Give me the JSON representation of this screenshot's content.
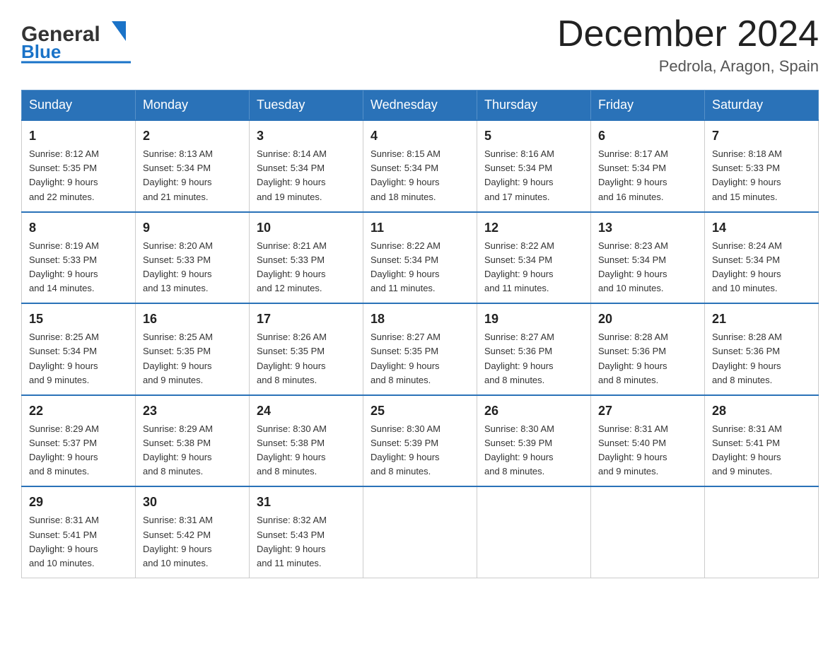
{
  "header": {
    "logo_general": "General",
    "logo_blue": "Blue",
    "month_title": "December 2024",
    "location": "Pedrola, Aragon, Spain"
  },
  "days_of_week": [
    "Sunday",
    "Monday",
    "Tuesday",
    "Wednesday",
    "Thursday",
    "Friday",
    "Saturday"
  ],
  "weeks": [
    [
      {
        "day": "1",
        "sunrise": "8:12 AM",
        "sunset": "5:35 PM",
        "daylight": "9 hours and 22 minutes."
      },
      {
        "day": "2",
        "sunrise": "8:13 AM",
        "sunset": "5:34 PM",
        "daylight": "9 hours and 21 minutes."
      },
      {
        "day": "3",
        "sunrise": "8:14 AM",
        "sunset": "5:34 PM",
        "daylight": "9 hours and 19 minutes."
      },
      {
        "day": "4",
        "sunrise": "8:15 AM",
        "sunset": "5:34 PM",
        "daylight": "9 hours and 18 minutes."
      },
      {
        "day": "5",
        "sunrise": "8:16 AM",
        "sunset": "5:34 PM",
        "daylight": "9 hours and 17 minutes."
      },
      {
        "day": "6",
        "sunrise": "8:17 AM",
        "sunset": "5:34 PM",
        "daylight": "9 hours and 16 minutes."
      },
      {
        "day": "7",
        "sunrise": "8:18 AM",
        "sunset": "5:33 PM",
        "daylight": "9 hours and 15 minutes."
      }
    ],
    [
      {
        "day": "8",
        "sunrise": "8:19 AM",
        "sunset": "5:33 PM",
        "daylight": "9 hours and 14 minutes."
      },
      {
        "day": "9",
        "sunrise": "8:20 AM",
        "sunset": "5:33 PM",
        "daylight": "9 hours and 13 minutes."
      },
      {
        "day": "10",
        "sunrise": "8:21 AM",
        "sunset": "5:33 PM",
        "daylight": "9 hours and 12 minutes."
      },
      {
        "day": "11",
        "sunrise": "8:22 AM",
        "sunset": "5:34 PM",
        "daylight": "9 hours and 11 minutes."
      },
      {
        "day": "12",
        "sunrise": "8:22 AM",
        "sunset": "5:34 PM",
        "daylight": "9 hours and 11 minutes."
      },
      {
        "day": "13",
        "sunrise": "8:23 AM",
        "sunset": "5:34 PM",
        "daylight": "9 hours and 10 minutes."
      },
      {
        "day": "14",
        "sunrise": "8:24 AM",
        "sunset": "5:34 PM",
        "daylight": "9 hours and 10 minutes."
      }
    ],
    [
      {
        "day": "15",
        "sunrise": "8:25 AM",
        "sunset": "5:34 PM",
        "daylight": "9 hours and 9 minutes."
      },
      {
        "day": "16",
        "sunrise": "8:25 AM",
        "sunset": "5:35 PM",
        "daylight": "9 hours and 9 minutes."
      },
      {
        "day": "17",
        "sunrise": "8:26 AM",
        "sunset": "5:35 PM",
        "daylight": "9 hours and 8 minutes."
      },
      {
        "day": "18",
        "sunrise": "8:27 AM",
        "sunset": "5:35 PM",
        "daylight": "9 hours and 8 minutes."
      },
      {
        "day": "19",
        "sunrise": "8:27 AM",
        "sunset": "5:36 PM",
        "daylight": "9 hours and 8 minutes."
      },
      {
        "day": "20",
        "sunrise": "8:28 AM",
        "sunset": "5:36 PM",
        "daylight": "9 hours and 8 minutes."
      },
      {
        "day": "21",
        "sunrise": "8:28 AM",
        "sunset": "5:36 PM",
        "daylight": "9 hours and 8 minutes."
      }
    ],
    [
      {
        "day": "22",
        "sunrise": "8:29 AM",
        "sunset": "5:37 PM",
        "daylight": "9 hours and 8 minutes."
      },
      {
        "day": "23",
        "sunrise": "8:29 AM",
        "sunset": "5:38 PM",
        "daylight": "9 hours and 8 minutes."
      },
      {
        "day": "24",
        "sunrise": "8:30 AM",
        "sunset": "5:38 PM",
        "daylight": "9 hours and 8 minutes."
      },
      {
        "day": "25",
        "sunrise": "8:30 AM",
        "sunset": "5:39 PM",
        "daylight": "9 hours and 8 minutes."
      },
      {
        "day": "26",
        "sunrise": "8:30 AM",
        "sunset": "5:39 PM",
        "daylight": "9 hours and 8 minutes."
      },
      {
        "day": "27",
        "sunrise": "8:31 AM",
        "sunset": "5:40 PM",
        "daylight": "9 hours and 9 minutes."
      },
      {
        "day": "28",
        "sunrise": "8:31 AM",
        "sunset": "5:41 PM",
        "daylight": "9 hours and 9 minutes."
      }
    ],
    [
      {
        "day": "29",
        "sunrise": "8:31 AM",
        "sunset": "5:41 PM",
        "daylight": "9 hours and 10 minutes."
      },
      {
        "day": "30",
        "sunrise": "8:31 AM",
        "sunset": "5:42 PM",
        "daylight": "9 hours and 10 minutes."
      },
      {
        "day": "31",
        "sunrise": "8:32 AM",
        "sunset": "5:43 PM",
        "daylight": "9 hours and 11 minutes."
      },
      null,
      null,
      null,
      null
    ]
  ],
  "labels": {
    "sunrise": "Sunrise:",
    "sunset": "Sunset:",
    "daylight": "Daylight:"
  }
}
